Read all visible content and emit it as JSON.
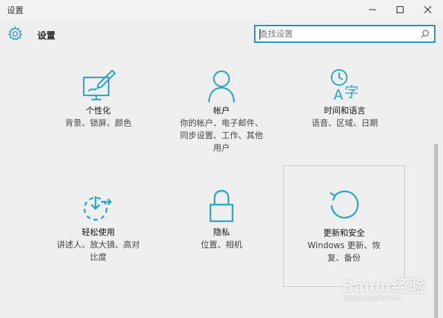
{
  "window": {
    "title": "设置"
  },
  "header": {
    "title": "设置"
  },
  "search": {
    "placeholder": "查找设置",
    "value": ""
  },
  "categories": [
    {
      "name": "个性化",
      "desc": [
        "背景、锁屏、颜色"
      ]
    },
    {
      "name": "帐户",
      "desc": [
        "你的帐户、电子邮件、",
        "同步设置、工作、其他",
        "用户"
      ]
    },
    {
      "name": "时间和语言",
      "desc": [
        "语音、区域、日期"
      ]
    },
    {
      "name": "轻松使用",
      "desc": [
        "讲述人、放大镜、高对",
        "比度"
      ]
    },
    {
      "name": "隐私",
      "desc": [
        "位置、相机"
      ]
    },
    {
      "name": "更新和安全",
      "desc": [
        "Windows 更新、恢",
        "复、备份"
      ]
    }
  ],
  "watermark": {
    "brand": "Baidu经验",
    "url": "jingyan.baidu.com"
  },
  "colors": {
    "accent": "#1a8fd4",
    "icon": "#2aa6c9",
    "background": "#efefef"
  }
}
